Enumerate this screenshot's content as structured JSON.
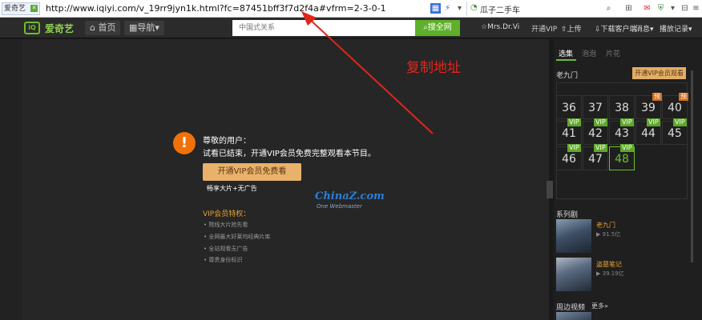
{
  "browser": {
    "tab_label": "爱奇艺",
    "url": "http://www.iqiyi.com/v_19rr9jyn1k.html?fc=87451bff3f7d2f4a#vfrm=2-3-0-1",
    "search_text": "瓜子二手车"
  },
  "nav": {
    "logo_text": "爱奇艺",
    "home_label": "首页",
    "guide_label": "导航",
    "search_placeholder": "中国式关系",
    "search_button": "搜全网",
    "links": [
      "☆Mrs.Dr.Vi",
      "开通VIP",
      "上传",
      "下载客户端",
      "消息",
      "播放记录"
    ]
  },
  "player": {
    "greeting": "尊敬的用户：",
    "message": "试看已结束，开通VIP会员免费完整观看本节目。",
    "vip_button": "开通VIP会员免费看",
    "vip_sub": "畅享大片+无广告",
    "privileges_title": "VIP会员特权：",
    "privileges": [
      "院线大片抢先看",
      "全网最大好莱坞经典片库",
      "全站观看无广告",
      "尊贵身份标识"
    ],
    "watermark": "ChinaZ.com",
    "watermark_sub": "One Webmaster"
  },
  "annotation": "复制地址",
  "panel": {
    "tabs": [
      "选集",
      "泡泡",
      "片花"
    ],
    "show_title": "老九门",
    "open_vip": "开通VIP会员观看",
    "episodes": [
      {
        "num": "36",
        "badge": ""
      },
      {
        "num": "37",
        "badge": ""
      },
      {
        "num": "38",
        "badge": ""
      },
      {
        "num": "39",
        "badge": "预"
      },
      {
        "num": "40",
        "badge": "预"
      },
      {
        "num": "41",
        "badge": "VIP"
      },
      {
        "num": "42",
        "badge": "VIP"
      },
      {
        "num": "43",
        "badge": "VIP"
      },
      {
        "num": "44",
        "badge": "VIP"
      },
      {
        "num": "45",
        "badge": "VIP"
      },
      {
        "num": "46",
        "badge": "VIP"
      },
      {
        "num": "47",
        "badge": "VIP"
      },
      {
        "num": "48",
        "badge": "VIP"
      }
    ],
    "series_title": "系列剧",
    "related": [
      {
        "name": "老九门",
        "plays": "91.5亿"
      },
      {
        "name": "盗墓笔记",
        "plays": "39.19亿"
      }
    ],
    "nearby_title": "周边视频",
    "more_label": "更多»"
  },
  "colors": {
    "accent": "#6bbf2b",
    "vip": "#e9b26a",
    "warning": "#f0700a",
    "annotation": "#e0251c"
  }
}
